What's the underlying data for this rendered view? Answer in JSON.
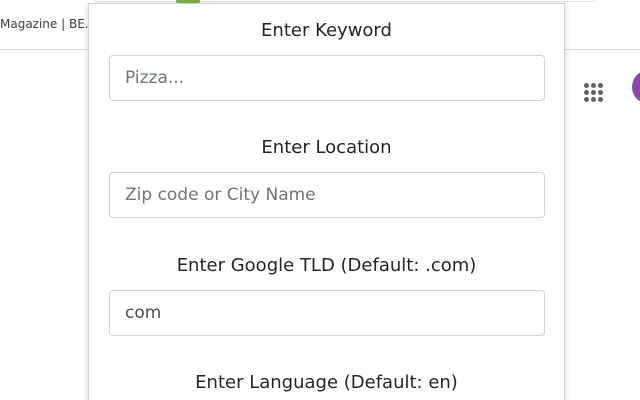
{
  "browser": {
    "bookmark_bar_text": "Magazine | BE."
  },
  "icons": {
    "apps": "apps-grid-icon",
    "avatar": "account-avatar",
    "avatar_color": "#8e44ad"
  },
  "popup": {
    "fields": [
      {
        "label": "Enter Keyword",
        "placeholder": "Pizza...",
        "value": ""
      },
      {
        "label": "Enter Location",
        "placeholder": "Zip code or City Name",
        "value": ""
      },
      {
        "label": "Enter Google TLD (Default: .com)",
        "placeholder": "",
        "value": "com"
      },
      {
        "label": "Enter Language (Default: en)",
        "placeholder": "",
        "value": ""
      }
    ]
  }
}
